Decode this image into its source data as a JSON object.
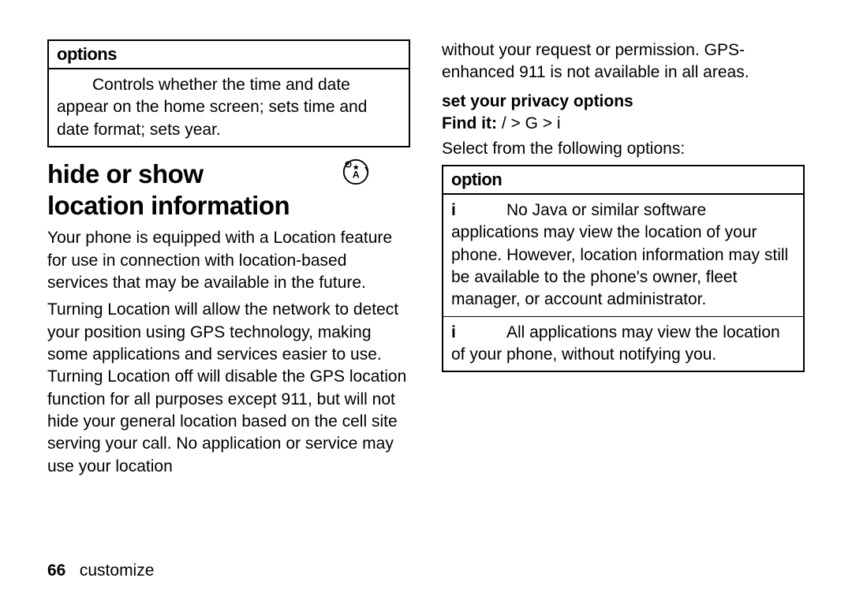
{
  "left": {
    "options_box": {
      "header": "options",
      "body": "Controls whether the time and date appear on the home screen; sets time and date format; sets year."
    },
    "section_title_line1": "hide or show",
    "section_title_line2": "location information",
    "icon_name": "location-info-icon",
    "para1": "Your phone is equipped with a Location feature for use in connection with location-based services that may be available in the future.",
    "para2": "Turning Location will allow the network to detect your position using GPS technology, making some applications and services easier to use. Turning Location off will disable the GPS location function for all purposes except 911, but will not hide your general location based on the cell site serving your call. No application or service may use your location"
  },
  "right": {
    "continuation": "without your request or permission. GPS-enhanced 911 is not available in all areas.",
    "subheading": "set your privacy options",
    "findit_prefix": "Find it:",
    "findit_path": " /   > G  > i",
    "select_intro": "Select from the following options:",
    "option_box": {
      "header": "option",
      "rows": [
        {
          "label": "i",
          "text": "No Java or similar software applications may view the location of your phone. However, location information may still be available to the phone's owner, fleet manager, or account administrator."
        },
        {
          "label": "i",
          "text": "All applications may view the location of your phone, without notifying you."
        }
      ]
    }
  },
  "footer": {
    "page_number": "66",
    "section": "customize"
  }
}
